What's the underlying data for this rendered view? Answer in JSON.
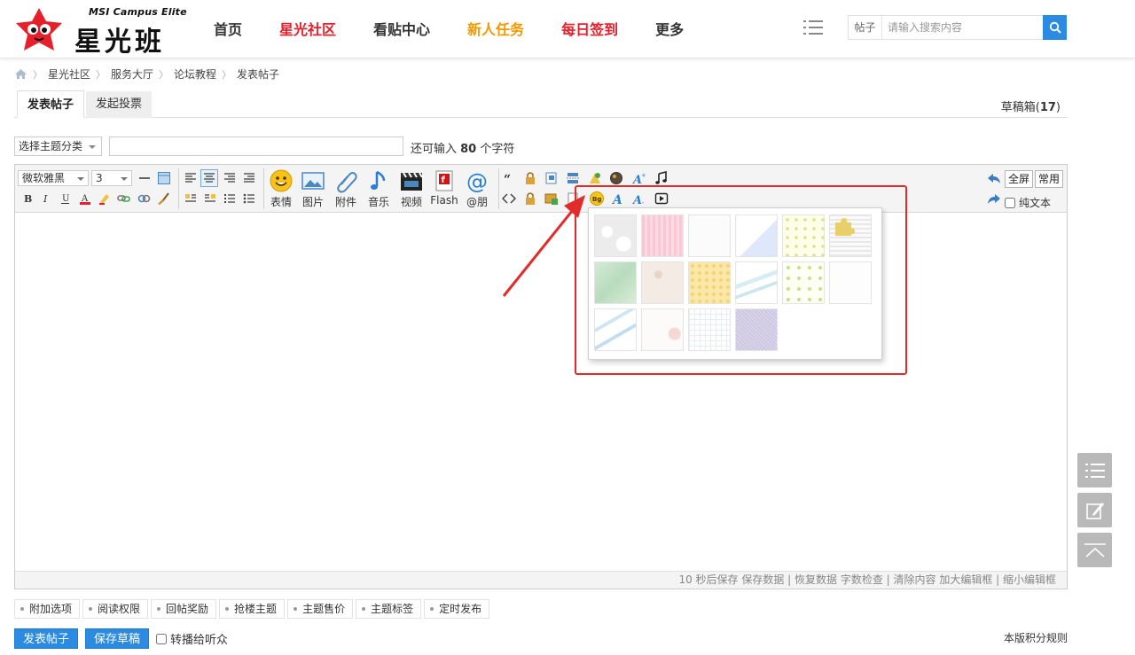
{
  "header": {
    "logo_en": "MSI Campus Elite",
    "logo_cn": "星光班",
    "nav": [
      "首页",
      "星光社区",
      "看贴中心",
      "新人任务",
      "每日签到",
      "更多"
    ],
    "search": {
      "type": "帖子",
      "placeholder": "请输入搜索内容"
    }
  },
  "breadcrumb": [
    "星光社区",
    "服务大厅",
    "论坛教程",
    "发表帖子"
  ],
  "tabs": {
    "post": "发表帖子",
    "poll": "发起投票"
  },
  "drafts": {
    "label": "草稿箱(",
    "count": "17",
    "close": ")"
  },
  "title_row": {
    "topic_select": "选择主题分类",
    "remain_prefix": "还可输入 ",
    "remain_count": "80",
    "remain_suffix": " 个字符"
  },
  "toolbar": {
    "font": "微软雅黑",
    "size": "3",
    "big_buttons": [
      "表情",
      "图片",
      "附件",
      "音乐",
      "视频",
      "Flash",
      "@朋"
    ],
    "fullscreen": "全屏",
    "common": "常用",
    "plain_text": "纯文本",
    "colors": {
      "accent": "#2b8be0",
      "highlight": "#e22b2b"
    }
  },
  "statusbar": "10 秒后保存 保存数据 | 恢复数据   字数检查 | 清除内容   加大编辑框 | 缩小编辑框",
  "options": [
    "附加选项",
    "阅读权限",
    "回帖奖励",
    "抢楼主题",
    "主题售价",
    "主题标签",
    "定时发布"
  ],
  "actions": {
    "submit": "发表帖子",
    "save_draft": "保存草稿",
    "broadcast": "转播给听众",
    "rules": "本版积分规则"
  }
}
